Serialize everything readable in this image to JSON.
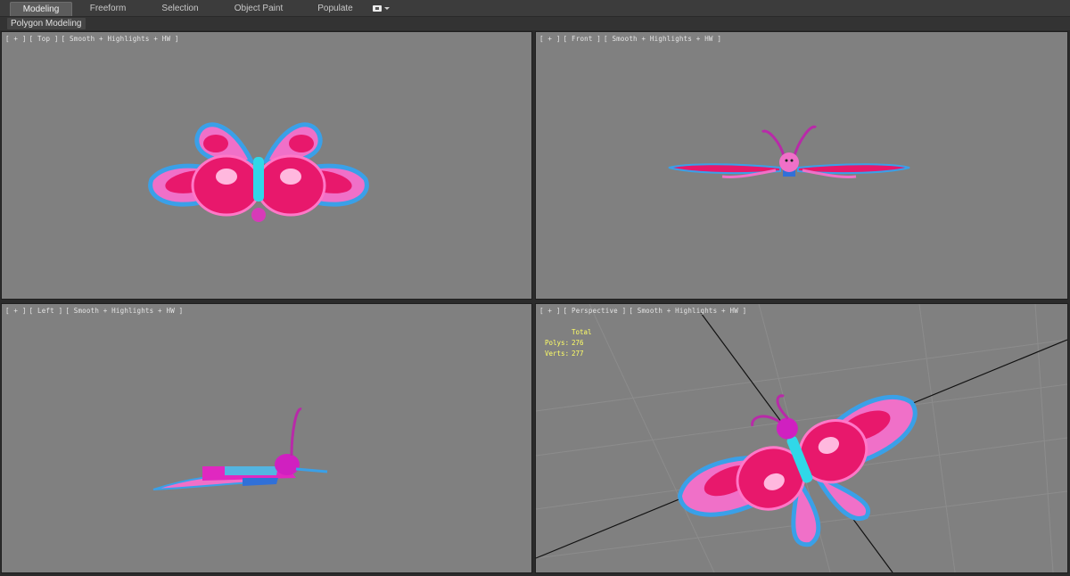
{
  "ribbon": {
    "tabs": [
      {
        "label": "Modeling",
        "active": true
      },
      {
        "label": "Freeform",
        "active": false
      },
      {
        "label": "Selection",
        "active": false
      },
      {
        "label": "Object Paint",
        "active": false
      },
      {
        "label": "Populate",
        "active": false
      }
    ],
    "panel_label": "Polygon Modeling",
    "options_icon": "ribbon-options-icon"
  },
  "viewports": {
    "top": {
      "menu": "[ + ]",
      "view": "[ Top ]",
      "shading": "[ Smooth + Highlights + HW ]"
    },
    "front": {
      "menu": "[ + ]",
      "view": "[ Front ]",
      "shading": "[ Smooth + Highlights + HW ]"
    },
    "left": {
      "menu": "[ + ]",
      "view": "[ Left ]",
      "shading": "[ Smooth + Highlights + HW ]"
    },
    "perspective": {
      "menu": "[ + ]",
      "view": "[ Perspective ]",
      "shading": "[ Smooth + Highlights + HW ]",
      "stats": {
        "header": "Total",
        "polys_label": "Polys:",
        "polys_value": "276",
        "verts_label": "Verts:",
        "verts_value": "277"
      }
    }
  },
  "colors": {
    "viewport_bg": "#808080",
    "wing_outline": "#3aa0e8",
    "wing_pink": "#f070c8",
    "wing_deep": "#e8186c",
    "body_cyan": "#30d8e8",
    "stats_text": "#ffff66"
  }
}
